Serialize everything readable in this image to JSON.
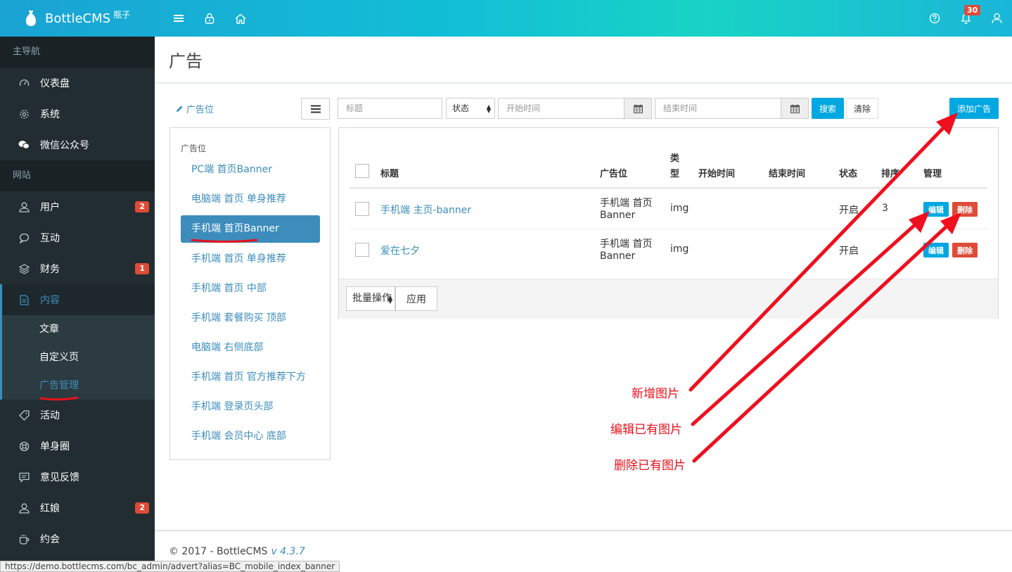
{
  "brand": {
    "name": "BottleCMS",
    "sub": "瓶子"
  },
  "header": {
    "notif_count": "30"
  },
  "sidebar": {
    "sections": [
      {
        "label": "主导航"
      },
      {
        "label": "网站"
      }
    ],
    "items": [
      {
        "label": "仪表盘",
        "icon": "dashboard-icon"
      },
      {
        "label": "系统",
        "icon": "gear-icon"
      },
      {
        "label": "微信公众号",
        "icon": "wechat-icon"
      },
      {
        "label": "用户",
        "icon": "user-icon",
        "badge": "2"
      },
      {
        "label": "互动",
        "icon": "comment-icon"
      },
      {
        "label": "财务",
        "icon": "layers-icon",
        "badge": "1"
      },
      {
        "label": "内容",
        "icon": "file-icon"
      },
      {
        "label": "活动",
        "icon": "tag-icon"
      },
      {
        "label": "单身圈",
        "icon": "lifebuoy-icon"
      },
      {
        "label": "意见反馈",
        "icon": "chat-icon"
      },
      {
        "label": "红娘",
        "icon": "user-icon",
        "badge": "2"
      },
      {
        "label": "约会",
        "icon": "cup-icon"
      }
    ],
    "subitems": [
      {
        "label": "文章"
      },
      {
        "label": "自定义页"
      },
      {
        "label": "广告管理"
      }
    ]
  },
  "page": {
    "title": "广告"
  },
  "adpos": {
    "link_label": "广告位",
    "caption": "广告位",
    "items": [
      "PC端 首页Banner",
      "电脑端 首页 单身推荐",
      "手机端 首页Banner",
      "手机端 首页 单身推荐",
      "手机端 首页 中部",
      "手机端 套餐购买 顶部",
      "电脑端 右侧底部",
      "手机端 首页 官方推荐下方",
      "手机端 登录页头部",
      "手机端 会员中心 底部"
    ]
  },
  "filters": {
    "title_placeholder": "标题",
    "status_label": "状态",
    "start_placeholder": "开始时间",
    "end_placeholder": "结束时间",
    "search_label": "搜索",
    "clear_label": "清除",
    "add_label": "添加广告"
  },
  "table": {
    "headers": {
      "title": "标题",
      "position": "广告位",
      "type_top": "类",
      "type_bottom": "型",
      "start": "开始时间",
      "end": "结束时间",
      "status": "状态",
      "sort": "排序",
      "manage": "管理"
    },
    "rows": [
      {
        "title": "手机端 主页-banner",
        "pos_line1": "手机端 首页",
        "pos_line2": "Banner",
        "type": "img",
        "status": "开启",
        "sort": "3"
      },
      {
        "title": "爱在七夕",
        "pos_line1": "手机端 首页",
        "pos_line2": "Banner",
        "type": "img",
        "status": "开启",
        "sort": ""
      }
    ],
    "edit_label": "编辑",
    "delete_label": "删除",
    "bulk_label": "批量操作",
    "apply_label": "应用"
  },
  "annotations": {
    "add": "新增图片",
    "edit": "编辑已有图片",
    "delete": "删除已有图片"
  },
  "footer": {
    "copyright": "© 2017 - BottleCMS",
    "version": "v 4.3.7"
  },
  "statusbar": {
    "url": "https://demo.bottlecms.com/bc_admin/advert?alias=BC_mobile_index_banner"
  },
  "colors": {
    "accent": "#3c8dbc",
    "danger": "#dd4b39",
    "info": "#00a7e0",
    "annotation": "#e8101c"
  }
}
